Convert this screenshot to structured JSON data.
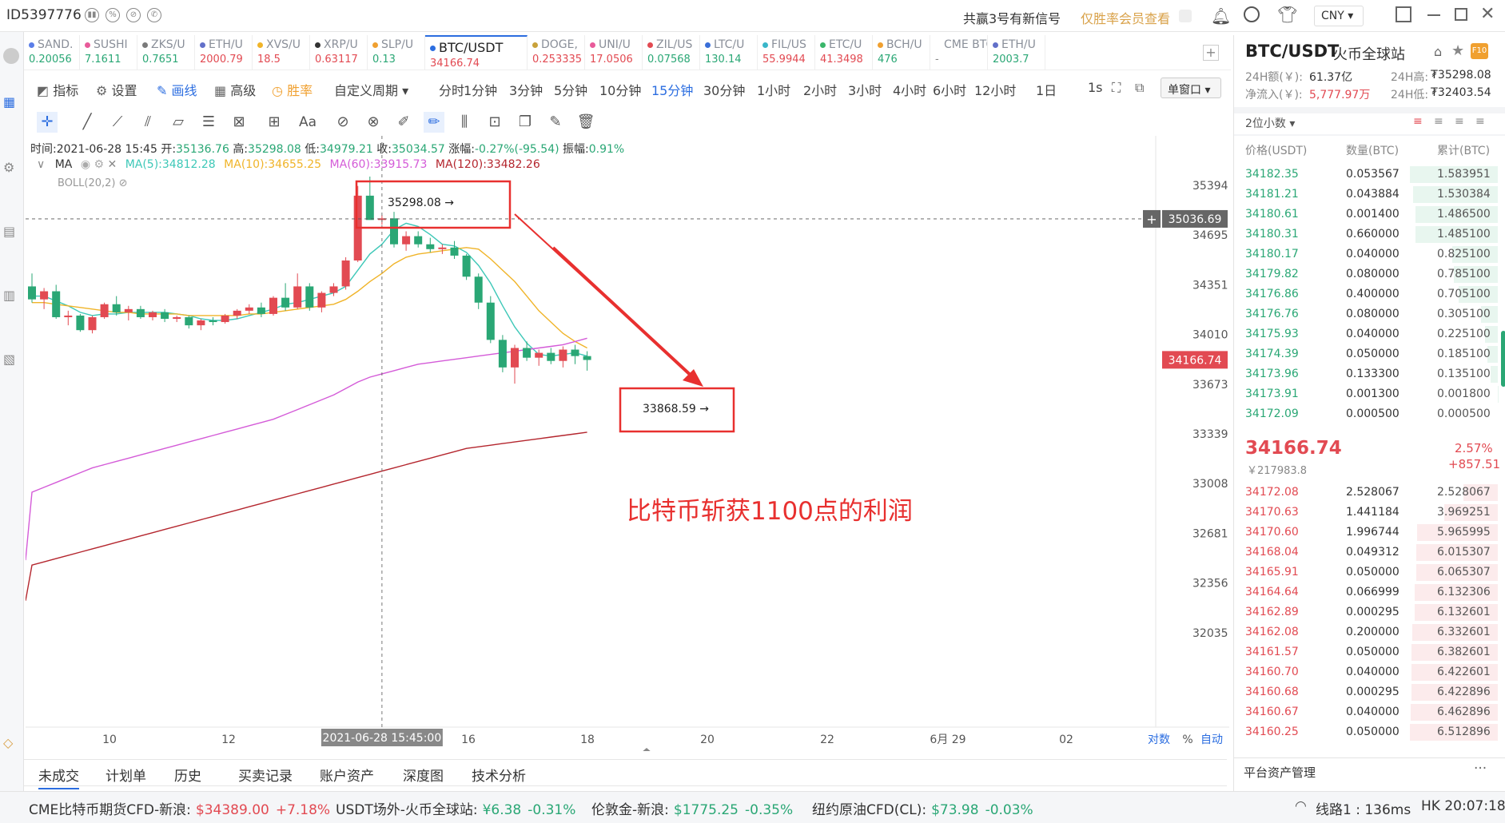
{
  "topbar": {
    "account_id": "ID5397776",
    "notice": "共赢3号有新信号",
    "vip_link": "仅胜率会员查看",
    "currency": "CNY"
  },
  "tickers": [
    {
      "name": "SAND.",
      "price": "0.20056",
      "color": "#2aa775",
      "dot": "#5b7ee8"
    },
    {
      "name": "SUSHI",
      "price": "7.1611",
      "color": "#2aa775",
      "dot": "#e85b9a"
    },
    {
      "name": "ZKS/U",
      "price": "0.7651",
      "color": "#2aa775",
      "dot": "#7a7a7a"
    },
    {
      "name": "ETH/U",
      "price": "2000.79",
      "color": "#e24a52",
      "dot": "#6270c9"
    },
    {
      "name": "XVS/U",
      "price": "18.5",
      "color": "#e24a52",
      "dot": "#f0b429"
    },
    {
      "name": "XRP/U",
      "price": "0.63117",
      "color": "#e24a52",
      "dot": "#333"
    },
    {
      "name": "SLP/U",
      "price": "0.13",
      "color": "#2aa775",
      "dot": "#f0a030"
    },
    {
      "name": "BTC/USDT",
      "price": "34166.74",
      "color": "#e24a52",
      "dot": "#2b6de0",
      "active": true
    },
    {
      "name": "DOGE,",
      "price": "0.253335",
      "color": "#e24a52",
      "dot": "#c9a23b"
    },
    {
      "name": "UNI/U",
      "price": "17.0506",
      "color": "#e24a52",
      "dot": "#e85b9a"
    },
    {
      "name": "ZIL/US",
      "price": "0.07568",
      "color": "#2aa775",
      "dot": "#e24a52"
    },
    {
      "name": "LTC/U",
      "price": "130.14",
      "color": "#2aa775",
      "dot": "#3a6fd8"
    },
    {
      "name": "FIL/US",
      "price": "55.9944",
      "color": "#e24a52",
      "dot": "#3ab6c9"
    },
    {
      "name": "ETC/U",
      "price": "41.3498",
      "color": "#e24a52",
      "dot": "#3ab66a"
    },
    {
      "name": "BCH/U",
      "price": "476",
      "color": "#2aa775",
      "dot": "#f0a030"
    },
    {
      "name": "CME BTC",
      "price": "-",
      "color": "#888",
      "dot": "#fff"
    },
    {
      "name": "ETH/U",
      "price": "2003.7",
      "color": "#2aa775",
      "dot": "#6270c9"
    }
  ],
  "toolbar": {
    "indicator": "指标",
    "settings": "设置",
    "draw": "画线",
    "advanced": "高级",
    "winrate": "胜率",
    "custom_period": "自定义周期",
    "periods": [
      "分时",
      "1分钟",
      "3分钟",
      "5分钟",
      "10分钟",
      "15分钟",
      "30分钟",
      "1小时",
      "2小时",
      "3小时",
      "4小时",
      "6小时",
      "12小时",
      "1日"
    ],
    "active_period": "15分钟",
    "interval": "1s",
    "window_mode": "单窗口"
  },
  "ohlc": {
    "time": "时间:2021-06-28 15:45",
    "open_label": "开:",
    "open": "35136.76",
    "high_label": "高:",
    "high": "35298.08",
    "low_label": "低:",
    "low": "34979.21",
    "close_label": "收:",
    "close": "35034.57",
    "change_label": "涨幅:",
    "change": "-0.27%(-95.54)",
    "amp_label": "振幅:",
    "amp": "0.91%"
  },
  "ma": {
    "title": "MA",
    "ma5": "MA(5):34812.28",
    "ma10": "MA(10):34655.25",
    "ma60": "MA(60):33915.73",
    "ma120": "MA(120):33482.26",
    "boll": "BOLL(20,2)"
  },
  "chart": {
    "price_axis": [
      "35394.84",
      "34695.99",
      "34351.76",
      "34010.95",
      "33673.52",
      "33339.43",
      "33008.66",
      "32681.17",
      "32356.93",
      "32035.91"
    ],
    "crosshair_price": "35036.69",
    "current_price": "34166.74",
    "high_marker": "35298.08 →",
    "low_marker": "33868.59 →",
    "annotation": "比特币斩获1100点的利润",
    "time_axis": [
      "10",
      "12",
      "14",
      "16",
      "18",
      "20",
      "22",
      "6月 29",
      "02"
    ],
    "crosshair_time": "2021-06-28 15:45:00",
    "axis_opts": [
      "对数",
      "%",
      "自动"
    ],
    "colors": {
      "up": "#e24a52",
      "down": "#2aa775",
      "ma5": "#3ec8b8",
      "ma10": "#f0b429",
      "ma60": "#d45bd8",
      "ma120": "#b4262e"
    }
  },
  "chart_data": {
    "type": "candlestick",
    "title": "BTC/USDT 15分钟",
    "ylim": [
      31900,
      35500
    ],
    "candles": [
      [
        34620,
        34700,
        34520,
        34540
      ],
      [
        34540,
        34610,
        34480,
        34590
      ],
      [
        34590,
        34630,
        34420,
        34430
      ],
      [
        34430,
        34470,
        34380,
        34440
      ],
      [
        34440,
        34450,
        34340,
        34350
      ],
      [
        34350,
        34440,
        34330,
        34430
      ],
      [
        34430,
        34520,
        34420,
        34510
      ],
      [
        34510,
        34560,
        34440,
        34460
      ],
      [
        34460,
        34500,
        34410,
        34480
      ],
      [
        34480,
        34500,
        34420,
        34430
      ],
      [
        34430,
        34470,
        34410,
        34460
      ],
      [
        34460,
        34480,
        34400,
        34420
      ],
      [
        34420,
        34440,
        34400,
        34430
      ],
      [
        34430,
        34440,
        34360,
        34380
      ],
      [
        34380,
        34420,
        34350,
        34410
      ],
      [
        34410,
        34430,
        34380,
        34400
      ],
      [
        34400,
        34450,
        34390,
        34440
      ],
      [
        34440,
        34480,
        34420,
        34470
      ],
      [
        34470,
        34510,
        34450,
        34490
      ],
      [
        34490,
        34520,
        34430,
        34450
      ],
      [
        34450,
        34560,
        34440,
        34550
      ],
      [
        34550,
        34640,
        34470,
        34490
      ],
      [
        34490,
        34700,
        34480,
        34620
      ],
      [
        34620,
        34640,
        34470,
        34490
      ],
      [
        34490,
        34590,
        34460,
        34580
      ],
      [
        34580,
        34640,
        34560,
        34620
      ],
      [
        34620,
        34800,
        34600,
        34780
      ],
      [
        34780,
        35240,
        34770,
        35180
      ],
      [
        35180,
        35298,
        35040,
        35030
      ],
      [
        35030,
        35060,
        35000,
        35040
      ],
      [
        35040,
        35080,
        34860,
        34880
      ],
      [
        34880,
        34960,
        34840,
        34930
      ],
      [
        34930,
        34960,
        34860,
        34880
      ],
      [
        34880,
        34920,
        34830,
        34850
      ],
      [
        34850,
        34880,
        34820,
        34860
      ],
      [
        34860,
        34900,
        34790,
        34810
      ],
      [
        34810,
        34820,
        34660,
        34680
      ],
      [
        34680,
        34700,
        34480,
        34520
      ],
      [
        34520,
        34560,
        34270,
        34290
      ],
      [
        34290,
        34320,
        34090,
        34120
      ],
      [
        34120,
        34260,
        34020,
        34240
      ],
      [
        34240,
        34280,
        34160,
        34180
      ],
      [
        34180,
        34230,
        34130,
        34210
      ],
      [
        34210,
        34240,
        34140,
        34160
      ],
      [
        34160,
        34250,
        34120,
        34230
      ],
      [
        34230,
        34260,
        34140,
        34190
      ],
      [
        34190,
        34220,
        34100,
        34166
      ]
    ],
    "series": [
      {
        "name": "MA(5)",
        "values": [
          34560,
          34560,
          34530,
          34500,
          34460,
          34440,
          34450,
          34450,
          34460,
          34460,
          34460,
          34460,
          34450,
          34440,
          34420,
          34410,
          34410,
          34420,
          34440,
          34460,
          34480,
          34510,
          34520,
          34540,
          34560,
          34580,
          34620,
          34720,
          34820,
          34880,
          34970,
          35010,
          34990,
          34940,
          34880,
          34870,
          34830,
          34750,
          34640,
          34500,
          34370,
          34270,
          34200,
          34190,
          34200,
          34210,
          34190
        ]
      },
      {
        "name": "MA(10)",
        "values": [
          34520,
          34520,
          34510,
          34500,
          34490,
          34480,
          34470,
          34460,
          34460,
          34450,
          34450,
          34450,
          34450,
          34440,
          34440,
          34440,
          34440,
          34440,
          34450,
          34450,
          34460,
          34470,
          34480,
          34490,
          34500,
          34510,
          34540,
          34590,
          34650,
          34700,
          34760,
          34800,
          34820,
          34830,
          34840,
          34850,
          34860,
          34850,
          34790,
          34720,
          34650,
          34560,
          34470,
          34400,
          34330,
          34280,
          34240
        ]
      },
      {
        "name": "MA(60)",
        "values": [
          33350,
          33380,
          33410,
          33440,
          33470,
          33500,
          33520,
          33540,
          33560,
          33580,
          33600,
          33620,
          33640,
          33660,
          33680,
          33700,
          33720,
          33740,
          33760,
          33780,
          33800,
          33830,
          33860,
          33890,
          33920,
          33950,
          33990,
          34030,
          34060,
          34080,
          34100,
          34120,
          34140,
          34150,
          34160,
          34170,
          34180,
          34190,
          34200,
          34210,
          34220,
          34230,
          34240,
          34250,
          34260,
          34280,
          34300
        ]
      },
      {
        "name": "MA(120)",
        "values": [
          32900,
          32920,
          32940,
          32960,
          32980,
          33000,
          33020,
          33040,
          33060,
          33080,
          33100,
          33120,
          33140,
          33160,
          33180,
          33200,
          33220,
          33240,
          33260,
          33280,
          33300,
          33320,
          33340,
          33360,
          33380,
          33400,
          33420,
          33440,
          33460,
          33480,
          33500,
          33520,
          33540,
          33560,
          33580,
          33600,
          33620,
          33630,
          33640,
          33650,
          33660,
          33670,
          33680,
          33690,
          33700,
          33710,
          33720
        ]
      }
    ]
  },
  "bottom_tabs": [
    "未成交",
    "计划单",
    "历史",
    "买卖记录",
    "账户资产",
    "深度图",
    "技术分析"
  ],
  "statusbar": {
    "items": [
      {
        "label": "CME比特币期货CFD-新浪:",
        "price": "$34389.00",
        "change": "+7.18%",
        "dir": "up"
      },
      {
        "label": "USDT场外-火币全球站:",
        "price": "¥6.38",
        "change": "-0.31%",
        "dir": "down"
      },
      {
        "label": "伦敦金-新浪:",
        "price": "$1775.25",
        "change": "-0.35%",
        "dir": "down"
      },
      {
        "label": "纽约原油CFD(CL):",
        "price": "$73.98",
        "change": "-0.03%",
        "dir": "down"
      }
    ],
    "latency": "线路1 : 136ms",
    "clock": "HK 20:07:18"
  },
  "rightpanel": {
    "pair": "BTC/USDT",
    "exchange": "火币全球站",
    "vol_label": "24H额(￥):",
    "vol": "61.37亿",
    "high_label": "24H高:",
    "high24": "₮35298.08",
    "inflow_label": "净流入(￥):",
    "inflow": "5,777.97万",
    "low_label": "24H低:",
    "low24": "₮32403.54",
    "decimals": "2位小数",
    "headers": [
      "价格(USDT)",
      "数量(BTC)",
      "累计(BTC)"
    ],
    "asks": [
      [
        "34182.35",
        "0.053567",
        "1.583951"
      ],
      [
        "34181.21",
        "0.043884",
        "1.530384"
      ],
      [
        "34180.61",
        "0.001400",
        "1.486500"
      ],
      [
        "34180.31",
        "0.660000",
        "1.485100"
      ],
      [
        "34180.17",
        "0.040000",
        "0.825100"
      ],
      [
        "34179.82",
        "0.080000",
        "0.785100"
      ],
      [
        "34176.86",
        "0.400000",
        "0.705100"
      ],
      [
        "34176.76",
        "0.080000",
        "0.305100"
      ],
      [
        "34175.93",
        "0.040000",
        "0.225100"
      ],
      [
        "34174.39",
        "0.050000",
        "0.185100"
      ],
      [
        "34173.96",
        "0.133300",
        "0.135100"
      ],
      [
        "34173.91",
        "0.001300",
        "0.001800"
      ],
      [
        "34172.09",
        "0.000500",
        "0.000500"
      ]
    ],
    "last_price": "34166.74",
    "last_cny": "￥217983.8",
    "pct": "2.57%",
    "chg": "+857.51",
    "bids": [
      [
        "34172.08",
        "2.528067",
        "2.528067"
      ],
      [
        "34170.63",
        "1.441184",
        "3.969251"
      ],
      [
        "34170.60",
        "1.996744",
        "5.965995"
      ],
      [
        "34168.04",
        "0.049312",
        "6.015307"
      ],
      [
        "34165.91",
        "0.050000",
        "6.065307"
      ],
      [
        "34164.64",
        "0.066999",
        "6.132306"
      ],
      [
        "34162.89",
        "0.000295",
        "6.132601"
      ],
      [
        "34162.08",
        "0.200000",
        "6.332601"
      ],
      [
        "34161.57",
        "0.050000",
        "6.382601"
      ],
      [
        "34160.70",
        "0.040000",
        "6.422601"
      ],
      [
        "34160.68",
        "0.000295",
        "6.422896"
      ],
      [
        "34160.67",
        "0.040000",
        "6.462896"
      ],
      [
        "34160.25",
        "0.050000",
        "6.512896"
      ]
    ],
    "footer": "平台资产管理"
  }
}
